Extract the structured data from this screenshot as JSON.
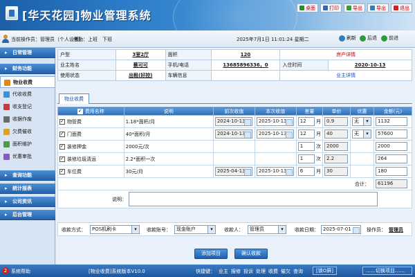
{
  "app": {
    "title": "[华天花园]物业管理系统"
  },
  "topnav": [
    {
      "label": "桌面",
      "icon": "home-icon",
      "color": "#2d8a2d"
    },
    {
      "label": "打印",
      "icon": "printer-icon",
      "color": "#3366aa"
    },
    {
      "label": "导出",
      "icon": "export-icon",
      "color": "#3a9a3a"
    },
    {
      "label": "导出",
      "icon": "export-alt-icon",
      "color": "#2f7fc0"
    },
    {
      "label": "退出",
      "icon": "exit-icon",
      "color": "#cc2222"
    }
  ],
  "infobar": {
    "operator": "当前操作员：管理员（个人设置）",
    "attendance": "考勤：上班　下班",
    "datetime": "2025年7月1日 11:01:24 星期二",
    "nav": [
      "刷新",
      "后退",
      "前进"
    ]
  },
  "sidebar": {
    "sections_top": [
      {
        "label": "日常管理"
      },
      {
        "label": "财务功能"
      }
    ],
    "items": [
      {
        "label": "物业收费",
        "color": "#d98b1f",
        "icon": "fee-icon",
        "active": true
      },
      {
        "label": "代收收费",
        "color": "#3f8fd6",
        "icon": "collect-icon"
      },
      {
        "label": "收支登记",
        "color": "#c83a3a",
        "icon": "ledger-icon"
      },
      {
        "label": "收据作废",
        "color": "#6a6a6a",
        "icon": "void-icon"
      },
      {
        "label": "欠费催收",
        "color": "#e0a020",
        "icon": "bell-icon"
      },
      {
        "label": "面积维护",
        "color": "#4a9a4a",
        "icon": "area-icon"
      },
      {
        "label": "优惠审批",
        "color": "#8a5ac0",
        "icon": "discount-icon"
      }
    ],
    "sections_bottom": [
      {
        "label": "查询功能"
      },
      {
        "label": "统计报表"
      },
      {
        "label": "公司资讯"
      },
      {
        "label": "后台管理"
      }
    ]
  },
  "house": {
    "row1": {
      "l1": "户型",
      "v1": "3室2厅",
      "l2": "面积",
      "v2": "120",
      "link": "房产详情"
    },
    "row2": {
      "l1": "业主姓名",
      "v1": "蔡可可",
      "l2": "手机/电话",
      "v2": "13685896336，0",
      "l3": "入住时间",
      "v3": "2020-10-13"
    },
    "row3": {
      "l1": "使用状态",
      "v1": "出租(好控)",
      "l2": "车辆信息",
      "link": "业主详情"
    }
  },
  "tab": "物业收费",
  "fees": {
    "headers": [
      "费用名称",
      "说明",
      "前次收值",
      "本次收值",
      "差量",
      "单价",
      "优惠",
      "金额(元)"
    ],
    "rows": [
      {
        "checked": true,
        "name": "物管费",
        "desc": "1.18*面积/月",
        "prev": "2024-10-13",
        "curr": "2025-10-13",
        "qty": "12",
        "unit": "月",
        "price": "0.9",
        "discount": "无",
        "amount": "1132"
      },
      {
        "checked": true,
        "name": "门面费",
        "desc": "40*面积/月",
        "prev": "2024-10-13",
        "curr": "2025-10-13",
        "qty": "12",
        "unit": "月",
        "price": "40",
        "discount": "无",
        "amount": "57600"
      },
      {
        "checked": true,
        "name": "装修押金",
        "desc": "2000元/次",
        "prev": "",
        "curr": "",
        "qty": "1",
        "unit": "次",
        "price": "2000",
        "discount": "",
        "amount": "2000"
      },
      {
        "checked": true,
        "name": "装修垃圾清运",
        "desc": "2.2*面积一次",
        "prev": "",
        "curr": "",
        "qty": "1",
        "unit": "次",
        "price": "2.2",
        "discount": "",
        "amount": "264"
      },
      {
        "checked": true,
        "name": "车位费",
        "desc": "30元/月",
        "prev": "2025-04-13",
        "curr": "2025-10-13",
        "qty": "6",
        "unit": "月",
        "price": "30",
        "discount": "",
        "amount": "180"
      }
    ],
    "total_label": "合计：",
    "total": "61196",
    "remark_label": "说明："
  },
  "payment": {
    "method_label": "收款方式：",
    "method": "POS机刷卡",
    "account_label": "收款账号：",
    "account": "现金账户",
    "payee_label": "收款人：",
    "payee": "管理员",
    "date_label": "收款日期：",
    "date": "2025-07-01",
    "operator_label": "操作员：",
    "operator": "管理员"
  },
  "buttons": {
    "add": "添加项目",
    "confirm": "确认收款"
  },
  "statusbar": {
    "help_count": "2",
    "help": "系统帮助",
    "module": "[物业收费]系统版本V10.0",
    "quick_label": "快捷键：",
    "quick": [
      "业主",
      "报修",
      "投诉",
      "处理",
      "收费",
      "催欠",
      "查询"
    ],
    "lock": "[锁O屏]",
    "switch": "……切换项目……"
  }
}
